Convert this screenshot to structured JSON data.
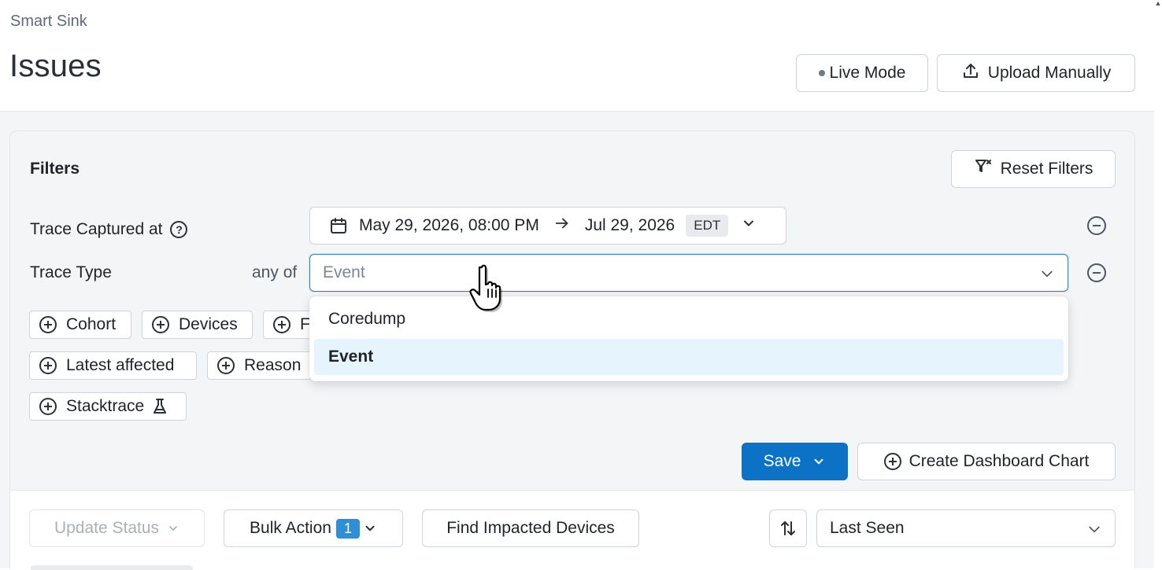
{
  "header": {
    "breadcrumb": "Smart Sink",
    "title": "Issues",
    "live_mode_label": "Live Mode",
    "upload_label": "Upload Manually"
  },
  "filters": {
    "title": "Filters",
    "reset_label": "Reset Filters",
    "trace_captured": {
      "label": "Trace Captured at",
      "start": "May 29, 2026, 08:00 PM",
      "end": "Jul 29, 2026",
      "timezone": "EDT"
    },
    "trace_type": {
      "label": "Trace Type",
      "operator": "any of",
      "placeholder": "Event",
      "options": [
        "Coredump",
        "Event"
      ],
      "highlighted": "Event"
    },
    "chips": {
      "cohort": "Cohort",
      "devices": "Devices",
      "f_partial": "F",
      "latest_affected": "Latest affected",
      "reason": "Reason",
      "stacktrace": "Stacktrace"
    },
    "save_label": "Save",
    "create_chart_label": "Create Dashboard Chart"
  },
  "toolbar": {
    "update_status_label": "Update Status",
    "bulk_action_label": "Bulk Action",
    "bulk_count": "1",
    "find_devices_label": "Find Impacted Devices",
    "sort_value": "Last Seen"
  },
  "colors": {
    "primary": "#0b72c6",
    "badge": "#2f8fd6",
    "highlight": "#e6f4fd",
    "focus_border": "#2f81c7"
  },
  "icons": {
    "upload": "upload-icon",
    "filter_reset": "filter-x-icon",
    "calendar": "calendar-icon",
    "arrow_right": "arrow-right-icon",
    "chevron": "chevron-down-icon",
    "plus_circle": "plus-circle-icon",
    "minus_circle": "minus-circle-icon",
    "help": "help-circle-icon",
    "beaker": "beaker-icon",
    "sort": "sort-arrows-icon"
  }
}
